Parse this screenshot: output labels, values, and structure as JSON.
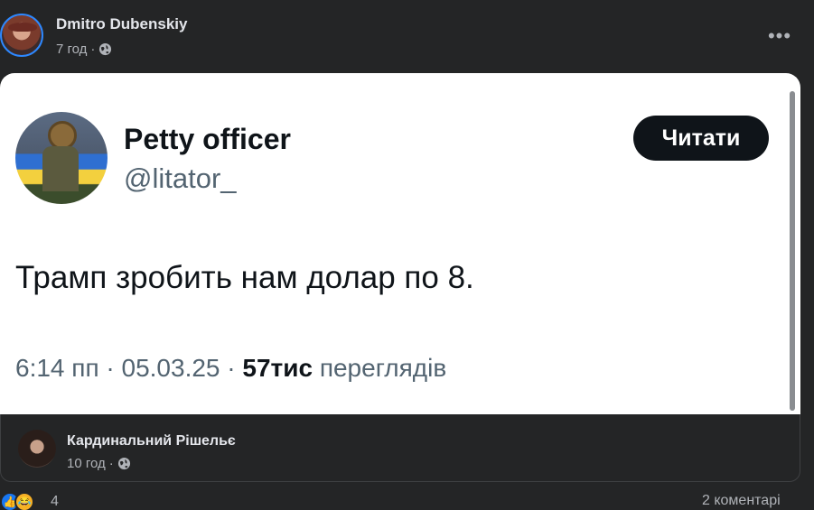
{
  "post": {
    "author": "Dmitro Dubenskiy",
    "time": "7 год",
    "separator": "·",
    "more_label": "•••"
  },
  "tweet": {
    "display_name": "Petty officer",
    "handle": "@litator_",
    "follow_label": "Читати",
    "text": "Трамп зробить нам долар по 8.",
    "time": "6:14 пп",
    "dot1": " · ",
    "date": "05.03.25",
    "dot2": " · ",
    "views_count": "57тис",
    "views_label": " переглядів"
  },
  "shared": {
    "author": "Кардинальний Рішельє",
    "time": "10 год",
    "separator": "·"
  },
  "reactions": {
    "count": "4",
    "comments": "2 коментарі"
  },
  "colors": {
    "background": "#242526",
    "follow_button": "#0f1419",
    "like_blue": "#1877f2",
    "haha_yellow": "#f7b125"
  }
}
